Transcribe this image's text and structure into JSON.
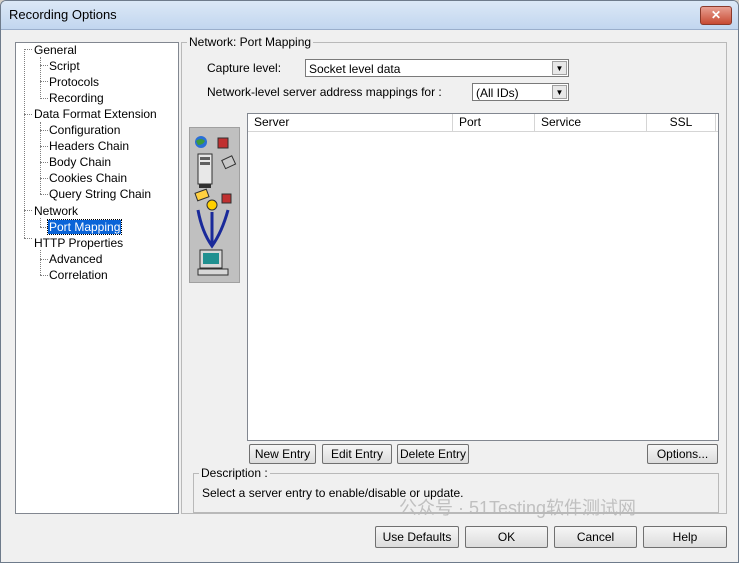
{
  "window": {
    "title": "Recording Options",
    "close_glyph": "✕"
  },
  "tree": {
    "items": [
      {
        "label": "General"
      },
      {
        "label": "Script"
      },
      {
        "label": "Protocols"
      },
      {
        "label": "Recording"
      },
      {
        "label": "Data Format Extension"
      },
      {
        "label": "Configuration"
      },
      {
        "label": "Headers Chain"
      },
      {
        "label": "Body Chain"
      },
      {
        "label": "Cookies Chain"
      },
      {
        "label": "Query String Chain"
      },
      {
        "label": "Network"
      },
      {
        "label": "Port Mapping"
      },
      {
        "label": "HTTP Properties"
      },
      {
        "label": "Advanced"
      },
      {
        "label": "Correlation"
      }
    ],
    "selected": "Port Mapping"
  },
  "panel": {
    "group_title": "Network: Port Mapping",
    "capture_label": "Capture level:",
    "capture_value": "Socket level data",
    "mapping_label": "Network-level server address mappings for :",
    "mapping_value": "(All IDs)",
    "arrow_glyph": "▼"
  },
  "table": {
    "columns": [
      "Server",
      "Port",
      "Service",
      "SSL"
    ],
    "rows": []
  },
  "buttons": {
    "new_entry": "New Entry",
    "edit_entry": "Edit Entry",
    "delete_entry": "Delete Entry",
    "options": "Options..."
  },
  "description": {
    "title": "Description :",
    "text": "Select a server entry to enable/disable or update."
  },
  "footer": {
    "use_defaults": "Use Defaults",
    "ok": "OK",
    "cancel": "Cancel",
    "help": "Help"
  },
  "watermark": "公众号 · 51Testing软件测试网",
  "icons": [
    "globe-icon",
    "server-icon",
    "database-icon",
    "connection-icon",
    "computer-icon"
  ]
}
